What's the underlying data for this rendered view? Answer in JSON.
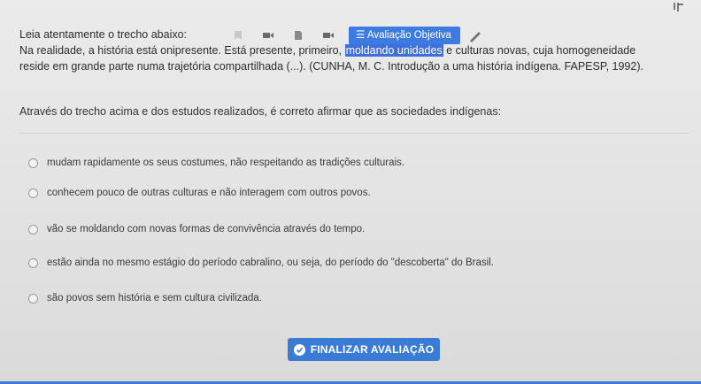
{
  "question": {
    "intro": "Leia atentamente o trecho abaixo:",
    "line2_pre": "Na realidade, a história está onipresente. Está presente, primeiro, ",
    "line2_highlight": "moldando unidades",
    "line2_post": " e culturas novas, cuja homogeneidade",
    "line3": "reside em grande parte numa trajetória compartilhada (...). (CUNHA, M. C. Introdução a uma história indígena. FAPESP, 1992).",
    "prompt": "Através do trecho acima e dos estudos realizados, é correto afirmar que as sociedades indígenas:"
  },
  "toolbar": {
    "eval_label": "Avaliação Objetiva",
    "icons": [
      "bookmark-icon",
      "video-icon",
      "document-icon",
      "video-icon",
      "list-icon",
      "pen-icon"
    ]
  },
  "options": [
    "mudam rapidamente os seus costumes, não respeitando as tradições culturais.",
    "conhecem pouco de outras culturas e não interagem com outros povos.",
    "vão se moldando com novas formas de convivência através do tempo.",
    "estão ainda no mesmo estágio do período cabralino, ou seja, do período do \"descoberta\" do Brasil.",
    "são povos sem história e sem cultura civilizada."
  ],
  "finish_label": "FINALIZAR AVALIAÇÃO",
  "colors": {
    "accent": "#3a7bd5",
    "highlight": "#3f6fd8"
  }
}
